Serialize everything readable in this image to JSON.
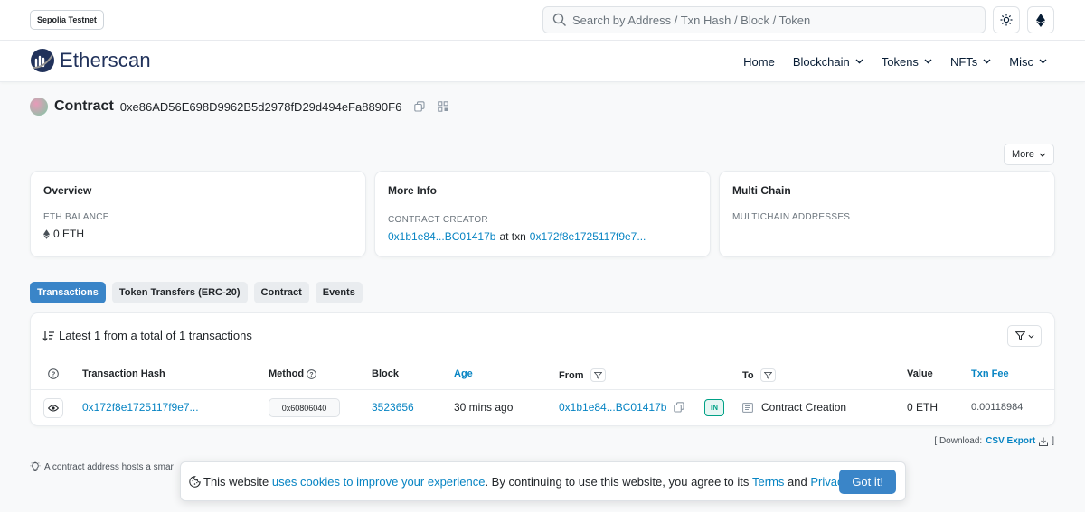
{
  "topbar": {
    "network_badge": "Sepolia Testnet",
    "search_placeholder": "Search by Address / Txn Hash / Block / Token"
  },
  "navbar": {
    "logo_text": "Etherscan",
    "items": [
      {
        "label": "Home",
        "has_dropdown": false
      },
      {
        "label": "Blockchain",
        "has_dropdown": true
      },
      {
        "label": "Tokens",
        "has_dropdown": true
      },
      {
        "label": "NFTs",
        "has_dropdown": true
      },
      {
        "label": "Misc",
        "has_dropdown": true
      }
    ]
  },
  "contract": {
    "title": "Contract",
    "address": "0xe86AD56E698D9962B5d2978fD29d494eFa8890F6"
  },
  "more_button": "More",
  "cards": {
    "overview": {
      "title": "Overview",
      "label": "ETH BALANCE",
      "value": "0 ETH"
    },
    "more_info": {
      "title": "More Info",
      "label": "CONTRACT CREATOR",
      "creator": "0x1b1e84...BC01417b",
      "at_txn": "at txn",
      "txn": "0x172f8e1725117f9e7..."
    },
    "multi_chain": {
      "title": "Multi Chain",
      "label": "MULTICHAIN ADDRESSES"
    }
  },
  "tabs": [
    {
      "label": "Transactions",
      "active": true
    },
    {
      "label": "Token Transfers (ERC-20)",
      "active": false
    },
    {
      "label": "Contract",
      "active": false
    },
    {
      "label": "Events",
      "active": false
    }
  ],
  "transactions": {
    "summary": "Latest 1 from a total of 1 transactions",
    "columns": {
      "hash": "Transaction Hash",
      "method": "Method",
      "block": "Block",
      "age": "Age",
      "from": "From",
      "to": "To",
      "value": "Value",
      "fee": "Txn Fee"
    },
    "rows": [
      {
        "hash": "0x172f8e1725117f9e7...",
        "method": "0x60806040",
        "block": "3523656",
        "age": "30 mins ago",
        "from": "0x1b1e84...BC01417b",
        "direction": "IN",
        "to": "Contract Creation",
        "value": "0 ETH",
        "fee": "0.00118984"
      }
    ]
  },
  "download": {
    "prefix": "[ Download:",
    "link": "CSV Export",
    "suffix": "]"
  },
  "hint": "A contract address hosts a smar",
  "cookie": {
    "text1": "This website",
    "link1": "uses cookies to improve your experience",
    "text2": ". By continuing to use this website, you agree to its",
    "link2": "Terms",
    "text3": "and",
    "link3": "Privacy Policy",
    "text4": ".",
    "button": "Got it!"
  },
  "colors": {
    "link": "#0784c3",
    "accent": "#3a85c8",
    "in_badge": "#00a186"
  }
}
